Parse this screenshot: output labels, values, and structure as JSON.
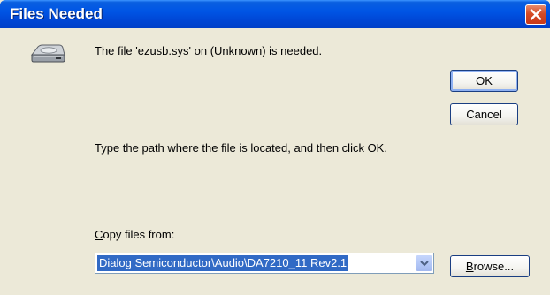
{
  "window": {
    "title": "Files Needed"
  },
  "message": {
    "needed": "The file 'ezusb.sys' on (Unknown) is needed.",
    "instruction": "Type the path where the file is located, and then click OK."
  },
  "copy_from": {
    "label_prefix": "",
    "label_accel": "C",
    "label_rest": "opy files from:",
    "value": "Dialog Semiconductor\\Audio\\DA7210_11 Rev2.1"
  },
  "buttons": {
    "ok": "OK",
    "cancel": "Cancel",
    "browse_accel": "B",
    "browse_rest": "rowse..."
  },
  "icons": {
    "drive": "disk-drive-icon",
    "close": "close-icon",
    "dropdown": "chevron-down-icon"
  },
  "colors": {
    "titlebar": "#0055e5",
    "close_button": "#d54b25",
    "selection": "#316ac5",
    "dialog_bg": "#ece9d8"
  }
}
